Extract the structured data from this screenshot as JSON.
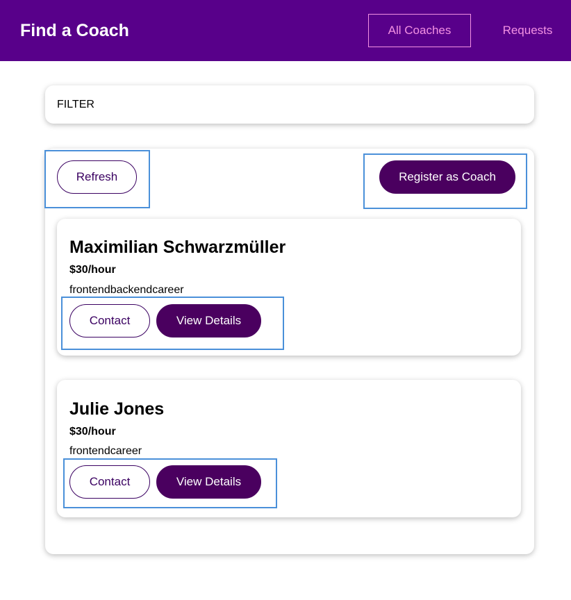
{
  "header": {
    "title": "Find a Coach",
    "nav": [
      {
        "label": "All Coaches"
      },
      {
        "label": "Requests"
      }
    ]
  },
  "filter": {
    "label": "FILTER"
  },
  "controls": {
    "refresh_label": "Refresh",
    "register_label": "Register as Coach"
  },
  "coaches": [
    {
      "name": "Maximilian Schwarzmüller",
      "rate": "$30/hour",
      "areas": "frontendbackendcareer",
      "contact_label": "Contact",
      "details_label": "View Details"
    },
    {
      "name": "Julie Jones",
      "rate": "$30/hour",
      "areas": "frontendcareer",
      "contact_label": "Contact",
      "details_label": "View Details"
    }
  ],
  "colors": {
    "header_bg": "#58008a",
    "nav_text": "#f391e3",
    "button_primary": "#4a005f",
    "highlight": "#4a90d9"
  }
}
